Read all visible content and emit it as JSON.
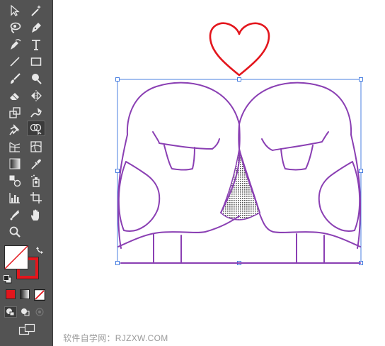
{
  "toolbar": {
    "tools": [
      {
        "name": "selection-tool",
        "icon": "arrow-icon",
        "active": false
      },
      {
        "name": "magic-wand-tool",
        "icon": "magic-wand-icon",
        "active": false
      },
      {
        "name": "lasso-tool",
        "icon": "lasso-icon",
        "active": false
      },
      {
        "name": "pen-tool",
        "icon": "pen-icon",
        "active": false
      },
      {
        "name": "curvature-tool",
        "icon": "curvature-icon",
        "active": false
      },
      {
        "name": "type-tool",
        "icon": "type-icon",
        "active": false
      },
      {
        "name": "line-tool",
        "icon": "line-segment-icon",
        "active": false
      },
      {
        "name": "rectangle-tool",
        "icon": "rectangle-icon",
        "active": false
      },
      {
        "name": "paintbrush-tool",
        "icon": "paintbrush-icon",
        "active": false
      },
      {
        "name": "shaper-tool",
        "icon": "shaper-icon",
        "active": false
      },
      {
        "name": "eraser-tool",
        "icon": "eraser-icon",
        "active": false
      },
      {
        "name": "reflect-tool",
        "icon": "reflect-icon",
        "active": false
      },
      {
        "name": "scale-tool",
        "icon": "scale-icon",
        "active": false
      },
      {
        "name": "warp-tool",
        "icon": "warp-icon",
        "active": false
      },
      {
        "name": "puppet-warp-tool",
        "icon": "pin-icon",
        "active": false
      },
      {
        "name": "shape-builder-tool",
        "icon": "shape-builder-icon",
        "active": true
      },
      {
        "name": "perspective-grid-tool",
        "icon": "perspective-grid-icon",
        "active": false
      },
      {
        "name": "mesh-tool",
        "icon": "mesh-icon",
        "active": false
      },
      {
        "name": "gradient-tool",
        "icon": "gradient-icon",
        "active": false
      },
      {
        "name": "eyedropper-tool",
        "icon": "eyedropper-icon",
        "active": false
      },
      {
        "name": "blend-tool",
        "icon": "blend-icon",
        "active": false
      },
      {
        "name": "symbol-sprayer-tool",
        "icon": "symbol-sprayer-icon",
        "active": false
      },
      {
        "name": "column-graph-tool",
        "icon": "column-graph-icon",
        "active": false
      },
      {
        "name": "artboard-tool",
        "icon": "artboard-icon",
        "active": false
      },
      {
        "name": "slice-tool",
        "icon": "slice-icon",
        "active": false
      },
      {
        "name": "hand-tool",
        "icon": "hand-icon",
        "active": false
      },
      {
        "name": "zoom-tool",
        "icon": "magnifier-icon",
        "active": false
      }
    ],
    "fill_color": "#ffffff",
    "stroke_color": "#e3161d",
    "color_mode_color": "#e3161d"
  },
  "canvas": {
    "heart_color": "#e3161d",
    "path_color": "#8a3fb3",
    "selection_color": "#4a7fe0",
    "fill_pattern_color": "#555555"
  },
  "watermark": {
    "text": "软件自学网：RJZXW.COM"
  }
}
